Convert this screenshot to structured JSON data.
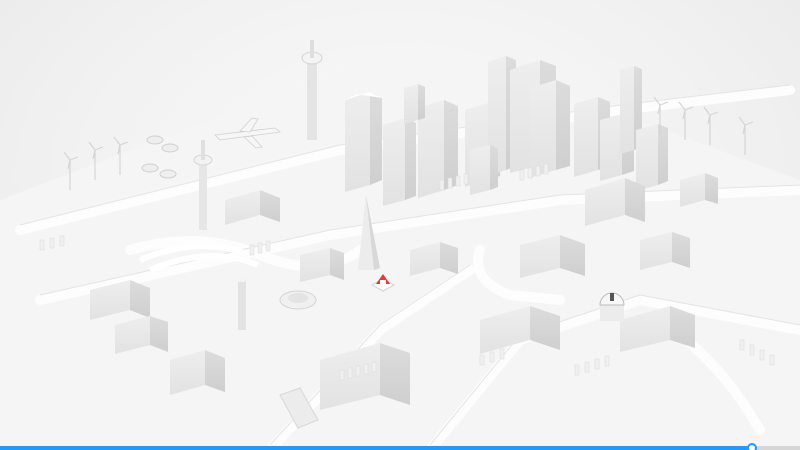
{
  "scene": {
    "description_icon": "isometric-white-city-icon",
    "marker_icon": "red-location-marker-icon",
    "marker_color": "#e53935",
    "accent_color": "#1e9bff",
    "observatory_icon": "observatory-dome-icon"
  },
  "progress": {
    "value": 0.94
  }
}
